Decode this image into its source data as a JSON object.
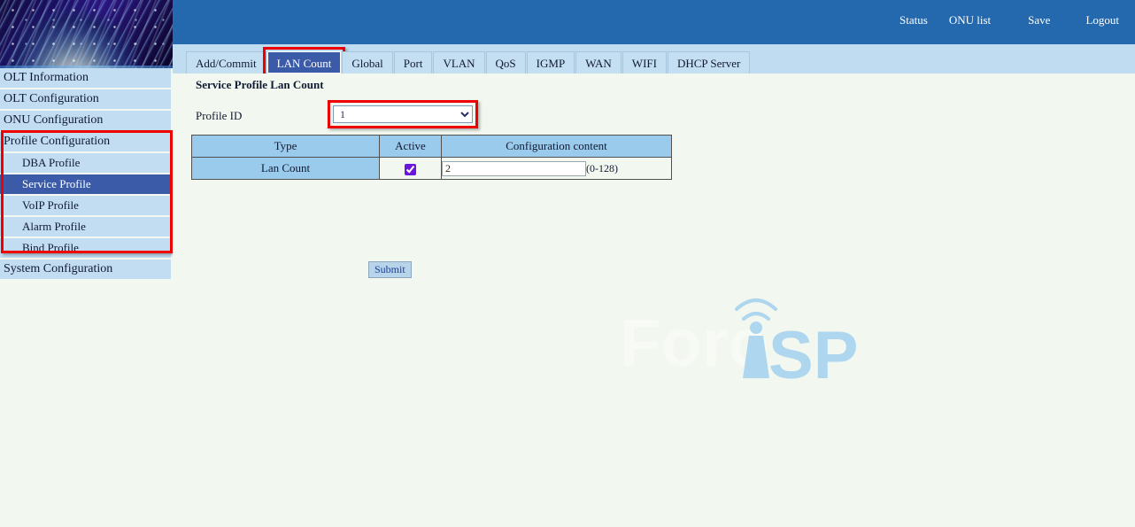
{
  "header": {
    "links": [
      {
        "label": "Status",
        "name": "header-link-status"
      },
      {
        "label": "ONU list",
        "name": "header-link-onu-list"
      },
      {
        "label": "Save",
        "name": "header-link-save"
      },
      {
        "label": "Logout",
        "name": "header-link-logout"
      }
    ],
    "background_color": "#2468ad"
  },
  "banner": {
    "alt": "fiber-optic globe banner"
  },
  "tabs": {
    "items": [
      {
        "label": "Add/Commit",
        "active": false
      },
      {
        "label": "LAN Count",
        "active": true
      },
      {
        "label": "Global",
        "active": false
      },
      {
        "label": "Port",
        "active": false
      },
      {
        "label": "VLAN",
        "active": false
      },
      {
        "label": "QoS",
        "active": false
      },
      {
        "label": "IGMP",
        "active": false
      },
      {
        "label": "WAN",
        "active": false
      },
      {
        "label": "WIFI",
        "active": false
      },
      {
        "label": "DHCP Server",
        "active": false
      }
    ],
    "active_label": "LAN Count",
    "active_color": "#3b5ba8",
    "annotation_color": "#ee0000"
  },
  "sidebar": {
    "items": [
      {
        "label": "OLT Information",
        "sub": false,
        "selected": false
      },
      {
        "label": "OLT Configuration",
        "sub": false,
        "selected": false
      },
      {
        "label": "ONU Configuration",
        "sub": false,
        "selected": false
      },
      {
        "label": "Profile Configuration",
        "sub": false,
        "selected": false
      },
      {
        "label": "DBA Profile",
        "sub": true,
        "selected": false
      },
      {
        "label": "Service Profile",
        "sub": true,
        "selected": true
      },
      {
        "label": "VoIP Profile",
        "sub": true,
        "selected": false
      },
      {
        "label": "Alarm Profile",
        "sub": true,
        "selected": false
      },
      {
        "label": "Bind Profile",
        "sub": true,
        "selected": false
      },
      {
        "label": "System Configuration",
        "sub": false,
        "selected": false
      }
    ],
    "selected_label": "Service Profile",
    "item_color": "#c2dcf2",
    "selected_color": "#3b5ba8"
  },
  "main": {
    "title": "Service Profile Lan Count",
    "profile_id": {
      "label": "Profile ID",
      "value": "1",
      "options": [
        "1"
      ]
    },
    "table": {
      "headers": [
        "Type",
        "Active",
        "Configuration content"
      ],
      "rows": [
        {
          "type": "Lan Count",
          "active": true,
          "value": "2",
          "range_hint": "(0-128)"
        }
      ],
      "header_color": "#9acbec"
    },
    "submit_label": "Submit"
  },
  "watermark": {
    "text_light": "Foro",
    "text_blue": "SP",
    "tower_letter": "i",
    "blue": "#aed6ef",
    "light": "#f7faf5"
  },
  "page": {
    "background_color": "#f2f7ef"
  }
}
